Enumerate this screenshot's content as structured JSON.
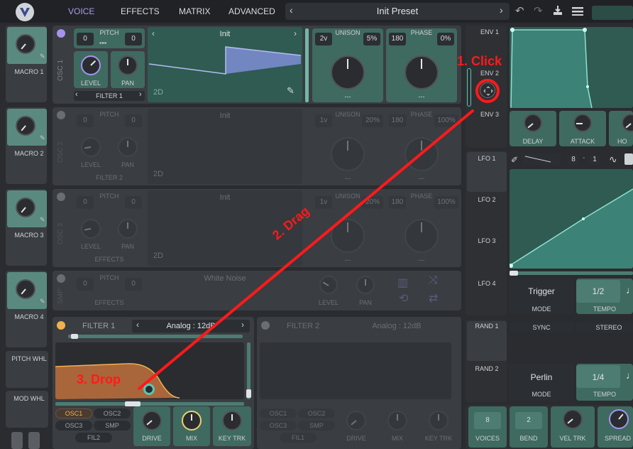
{
  "topbar": {
    "tabs": [
      "VOICE",
      "EFFECTS",
      "MATRIX",
      "ADVANCED"
    ],
    "preset": "Init Preset"
  },
  "macros": [
    {
      "label": "MACRO 1"
    },
    {
      "label": "MACRO 2"
    },
    {
      "label": "MACRO 3"
    },
    {
      "label": "MACRO 4"
    }
  ],
  "wheels": {
    "pitch": "PITCH WHL",
    "mod": "MOD WHL"
  },
  "osc1": {
    "tag": "OSC 1",
    "pitch_label": "PITCH",
    "pitch_left": "0",
    "pitch_right": "0",
    "level": "LEVEL",
    "pan": "PAN",
    "route": "FILTER 1",
    "wave": "Init",
    "dim_label": "2D",
    "unison_label": "UNISON",
    "unison_voices": "2v",
    "unison_detune": "5%",
    "phase_label": "PHASE",
    "phase_value": "180",
    "phase_random": "0%",
    "dash": "---"
  },
  "osc2": {
    "tag": "OSC 2",
    "pitch_label": "PITCH",
    "pitch_left": "0",
    "pitch_right": "0",
    "level": "LEVEL",
    "pan": "PAN",
    "route": "FILTER 2",
    "wave": "Init",
    "dim_label": "2D",
    "unison_label": "UNISON",
    "unison_voices": "1v",
    "unison_detune": "20%",
    "phase_label": "PHASE",
    "phase_value": "180",
    "phase_random": "100%",
    "dash": "---"
  },
  "osc3": {
    "tag": "OSC 3",
    "pitch_label": "PITCH",
    "pitch_left": "0",
    "pitch_right": "0",
    "level": "LEVEL",
    "pan": "PAN",
    "route": "EFFECTS",
    "wave": "Init",
    "dim_label": "2D",
    "unison_label": "UNISON",
    "unison_voices": "1v",
    "unison_detune": "20%",
    "phase_label": "PHASE",
    "phase_value": "180",
    "phase_random": "100%",
    "dash": "---"
  },
  "smp": {
    "tag": "SMP",
    "pitch_label": "PITCH",
    "pitch_left": "0",
    "pitch_right": "0",
    "route": "EFFECTS",
    "sample": "White Noise",
    "level": "LEVEL",
    "pan": "PAN"
  },
  "filter1": {
    "title": "FILTER 1",
    "model": "Analog : 12dB",
    "sources": [
      "OSC1",
      "OSC2",
      "OSC3",
      "SMP"
    ],
    "route": "FIL2",
    "drive": "DRIVE",
    "mix": "MIX",
    "keytrk": "KEY TRK"
  },
  "filter2": {
    "title": "FILTER 2",
    "model": "Analog : 12dB",
    "sources": [
      "OSC1",
      "OSC2",
      "OSC3",
      "SMP"
    ],
    "route": "FIL1",
    "drive": "DRIVE",
    "mix": "MIX",
    "keytrk": "KEY TRK"
  },
  "env": {
    "tabs": [
      "ENV 1",
      "ENV 2",
      "ENV 3"
    ],
    "knobs": [
      "DELAY",
      "ATTACK",
      "HO"
    ]
  },
  "lfo": {
    "tabs": [
      "LFO 1",
      "LFO 2",
      "LFO 3",
      "LFO 4"
    ],
    "grid_left": "8",
    "grid_right": "1",
    "mode_value": "Trigger",
    "mode_label": "MODE",
    "tempo_value": "1/2",
    "tempo_label": "TEMPO"
  },
  "rand": {
    "tabs": [
      "RAND 1",
      "RAND 2"
    ],
    "sync": "SYNC",
    "stereo": "STEREO",
    "mode_value": "Perlin",
    "mode_label": "MODE",
    "tempo_value": "1/4",
    "tempo_label": "TEMPO"
  },
  "voice": {
    "voices_value": "8",
    "voices_label": "VOICES",
    "bend_value": "2",
    "bend_label": "BEND",
    "veltrk_label": "VEL TRK",
    "spread_label": "SPREAD"
  },
  "annotations": {
    "step1": "1. Click",
    "step2": "2. Drag",
    "step3": "3. Drop",
    "color": "#ff1a1a"
  }
}
